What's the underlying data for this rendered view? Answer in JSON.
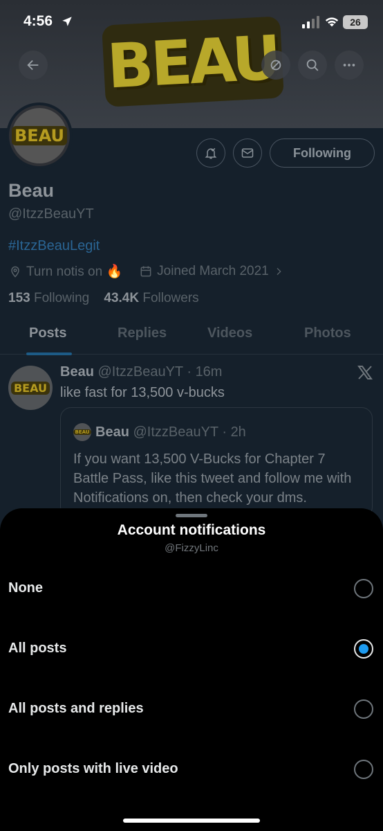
{
  "status_bar": {
    "time": "4:56",
    "battery": "26"
  },
  "banner": {
    "logo_text": "BEAU"
  },
  "profile": {
    "avatar_logo_text": "BEAU",
    "following_button": "Following",
    "name": "Beau",
    "handle": "@ItzzBeauYT",
    "bio": "#ItzzBeauLegit",
    "location": "Turn notis on 🔥",
    "joined": "Joined March 2021",
    "following_count": "153",
    "following_label": "Following",
    "followers_count": "43.4K",
    "followers_label": "Followers"
  },
  "tabs": [
    {
      "label": "Posts"
    },
    {
      "label": "Replies"
    },
    {
      "label": "Videos"
    },
    {
      "label": "Photos"
    }
  ],
  "post": {
    "avatar_logo_text": "BEAU",
    "author": "Beau",
    "handle_time": "@ItzzBeauYT · 16m",
    "text": "like fast for 13,500 v-bucks",
    "quote": {
      "avatar_logo_text": "BEAU",
      "author": "Beau",
      "handle_time": "@ItzzBeauYT · 2h",
      "text": "If you want 13,500 V-Bucks for Chapter 7 Battle Pass, like this tweet and follow me with Notifications on, then check your dms."
    }
  },
  "sheet": {
    "title": "Account notifications",
    "subtitle": "@FizzyLinc",
    "options": [
      {
        "label": "None",
        "selected": false
      },
      {
        "label": "All posts",
        "selected": true
      },
      {
        "label": "All posts and replies",
        "selected": false
      },
      {
        "label": "Only posts with live video",
        "selected": false
      }
    ]
  },
  "colors": {
    "accent": "#1d9bf0",
    "sheet_background": "#000000"
  }
}
